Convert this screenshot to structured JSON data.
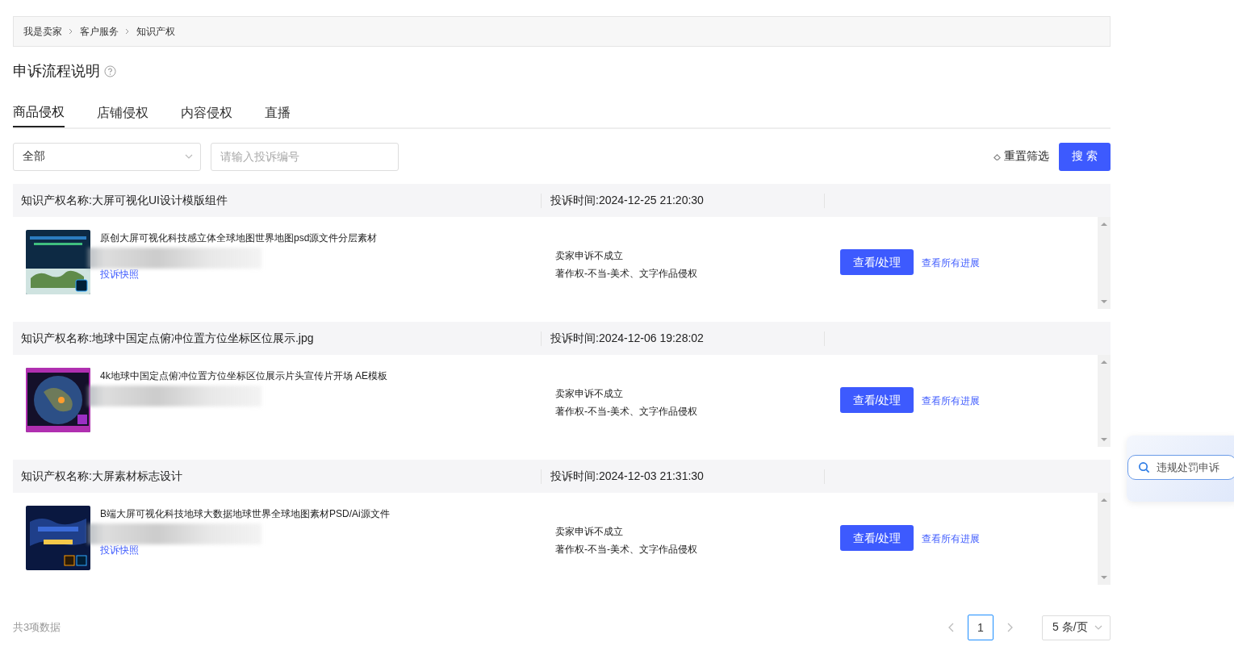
{
  "breadcrumb": [
    "我是卖家",
    "客户服务",
    "知识产权"
  ],
  "page_title": "申诉流程说明",
  "tabs": [
    {
      "label": "商品侵权",
      "selected": true
    },
    {
      "label": "店铺侵权",
      "selected": false
    },
    {
      "label": "内容侵权",
      "selected": false
    },
    {
      "label": "直播",
      "selected": false
    }
  ],
  "filter": {
    "select_value": "全部",
    "search_placeholder": "请输入投诉编号",
    "reset_label": "重置筛选",
    "search_button": "搜 索"
  },
  "complaints": [
    {
      "ip_name": "知识产权名称:大屏可视化UI设计模版组件",
      "time": "投诉时间:2024-12-25 21:20:30",
      "product_title": "原创大屏可视化科技感立体全球地图世界地图psd源文件分层素材",
      "snapshot_link": "投诉快照",
      "status": "卖家申诉不成立",
      "reason": "著作权-不当-美术、文字作品侵权",
      "action_button": "查看/处理",
      "progress_link": "查看所有进展"
    },
    {
      "ip_name": "知识产权名称:地球中国定点俯冲位置方位坐标区位展示.jpg",
      "time": "投诉时间:2024-12-06 19:28:02",
      "product_title": "4k地球中国定点俯冲位置方位坐标区位展示片头宣传片开场 AE模板",
      "status": "卖家申诉不成立",
      "reason": "著作权-不当-美术、文字作品侵权",
      "action_button": "查看/处理",
      "progress_link": "查看所有进展"
    },
    {
      "ip_name": "知识产权名称:大屏素材标志设计",
      "time": "投诉时间:2024-12-03 21:31:30",
      "product_title": "B端大屏可视化科技地球大数据地球世界全球地图素材PSD/Ai源文件",
      "snapshot_link": "投诉快照",
      "status": "卖家申诉不成立",
      "reason": "著作权-不当-美术、文字作品侵权",
      "action_button": "查看/处理",
      "progress_link": "查看所有进展"
    }
  ],
  "footer": {
    "total": "共3项数据",
    "pages": [
      {
        "label": "1",
        "selected": true
      }
    ],
    "page_size": "5 条/页"
  },
  "floating_search": {
    "label": "违规处罚申诉"
  }
}
